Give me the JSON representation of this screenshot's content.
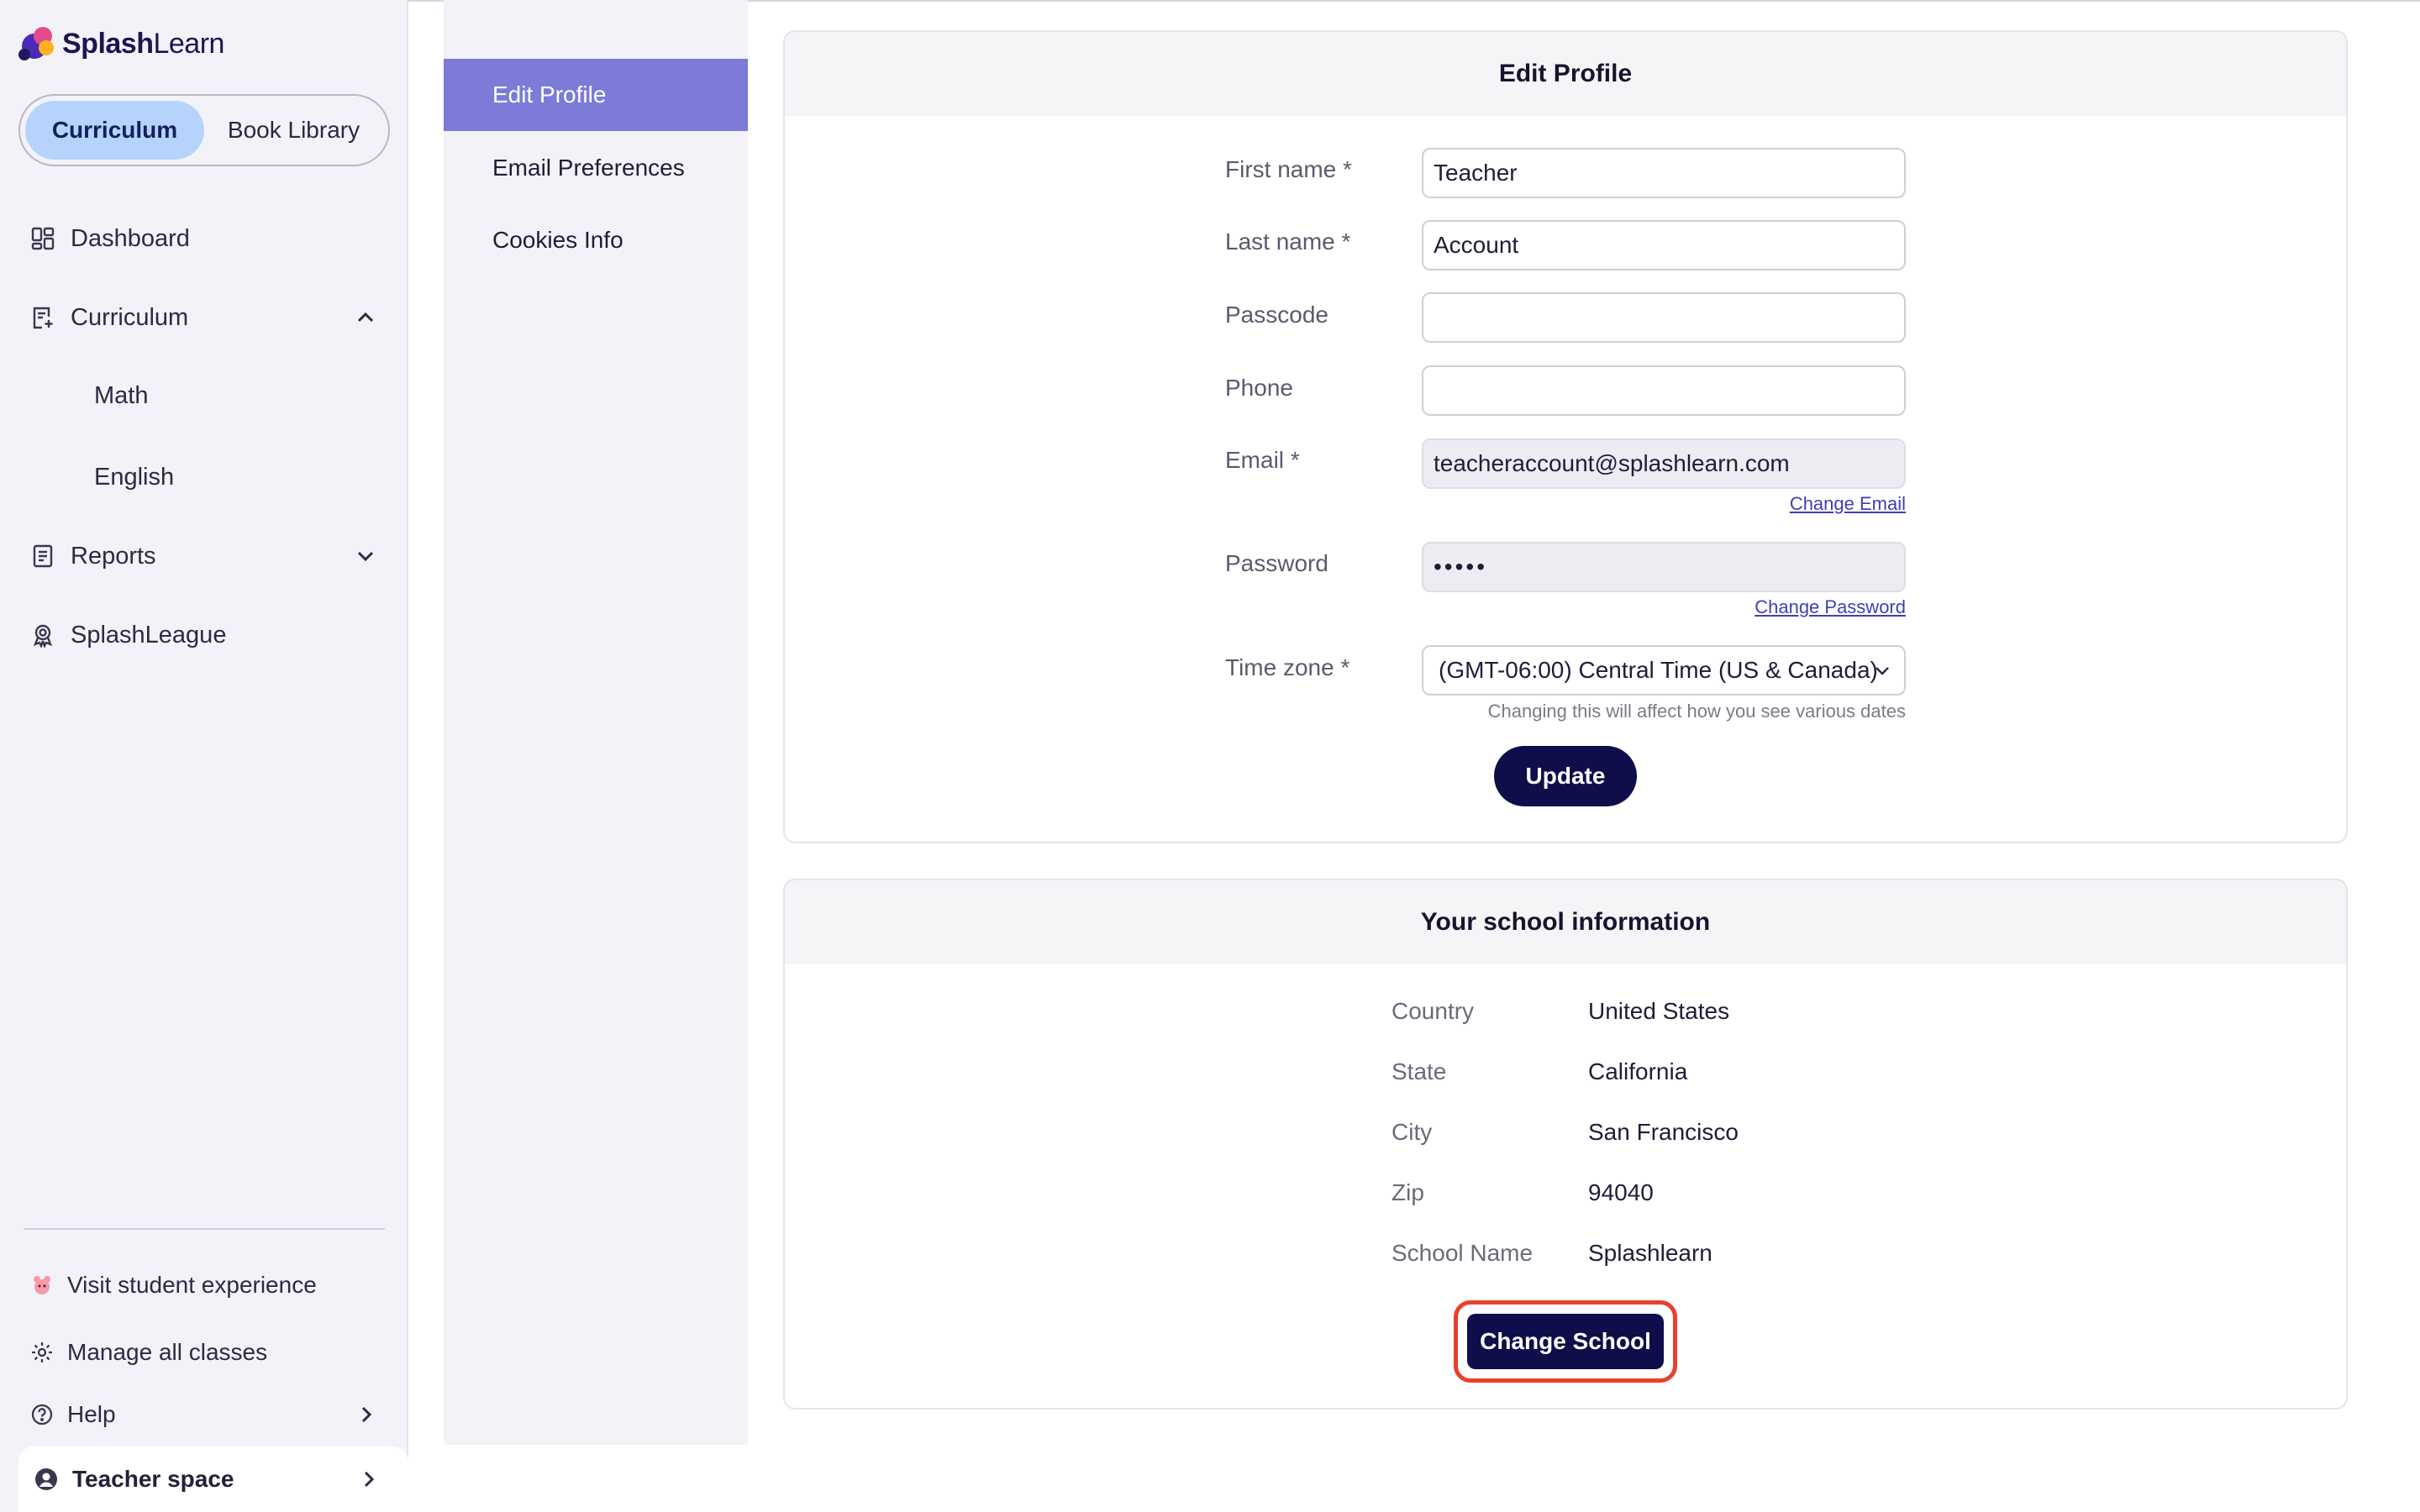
{
  "brand": {
    "name_bold": "Splash",
    "name_light": "Learn"
  },
  "segment": {
    "tabs": [
      {
        "label": "Curriculum",
        "active": true
      },
      {
        "label": "Book Library",
        "active": false
      }
    ]
  },
  "sidebar": {
    "items": [
      {
        "label": "Dashboard",
        "icon": "dashboard-icon"
      },
      {
        "label": "Curriculum",
        "icon": "curriculum-icon",
        "expanded": true
      },
      {
        "label": "Reports",
        "icon": "reports-icon",
        "expanded": false
      },
      {
        "label": "SplashLeague",
        "icon": "award-icon"
      }
    ],
    "curriculum_subitems": [
      "Math",
      "English"
    ],
    "bottom": {
      "visit_student": "Visit student experience",
      "manage_classes": "Manage all classes",
      "help": "Help",
      "teacher_space": "Teacher space"
    }
  },
  "submenu": {
    "items": [
      {
        "label": "Edit Profile",
        "active": true
      },
      {
        "label": "Email Preferences",
        "active": false
      },
      {
        "label": "Cookies Info",
        "active": false
      }
    ]
  },
  "edit_profile": {
    "title": "Edit Profile",
    "fields": {
      "first_name": {
        "label": "First name *",
        "value": "Teacher"
      },
      "last_name": {
        "label": "Last name *",
        "value": "Account"
      },
      "passcode": {
        "label": "Passcode",
        "value": ""
      },
      "phone": {
        "label": "Phone",
        "value": ""
      },
      "email": {
        "label": "Email *",
        "value": "teacheraccount@splashlearn.com",
        "link": "Change Email"
      },
      "password": {
        "label": "Password",
        "value": "•••••",
        "link": "Change Password"
      },
      "timezone": {
        "label": "Time zone *",
        "value": "(GMT-06:00) Central Time (US & Canada)",
        "hint": "Changing this will affect how you see various dates"
      }
    },
    "update_button": "Update"
  },
  "school": {
    "title": "Your school information",
    "rows": [
      {
        "label": "Country",
        "value": "United States"
      },
      {
        "label": "State",
        "value": "California"
      },
      {
        "label": "City",
        "value": "San Francisco"
      },
      {
        "label": "Zip",
        "value": "94040"
      },
      {
        "label": "School Name",
        "value": "Splashlearn"
      }
    ],
    "change_button": "Change School"
  },
  "colors": {
    "accent": "#7c7bd8",
    "primary_button": "#0d0e4a",
    "highlight": "#e8402c",
    "segment_active": "#b6d4fb"
  }
}
